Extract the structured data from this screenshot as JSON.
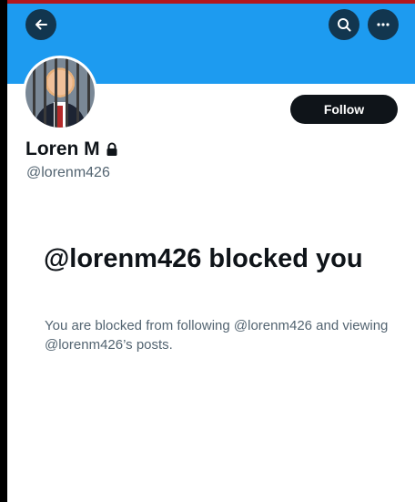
{
  "profile": {
    "display_name": "Loren M",
    "handle": "@lorenm426",
    "protected": true
  },
  "header": {
    "back_icon": "arrow-left-icon",
    "search_icon": "search-icon",
    "more_icon": "more-horizontal-icon"
  },
  "actions": {
    "follow_label": "Follow"
  },
  "blocked": {
    "title": "@lorenm426 blocked you",
    "description": "You are blocked from following @lorenm426 and viewing @lorenm426’s posts."
  },
  "colors": {
    "banner": "#1d9bf0",
    "primary_text": "#0f1419",
    "secondary_text": "#536471",
    "top_strip": "#b3171c"
  }
}
